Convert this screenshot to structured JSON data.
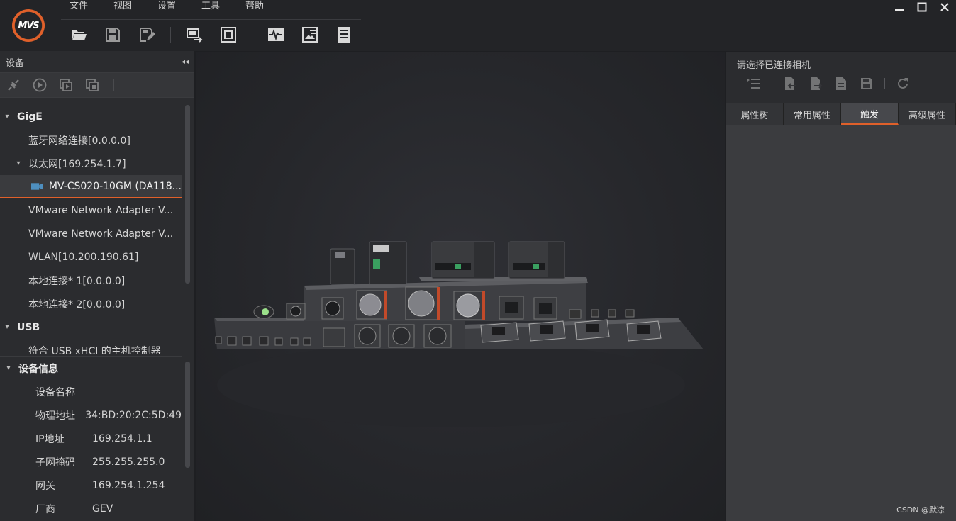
{
  "app": {
    "logo_text": "MVS",
    "menu": [
      "文件",
      "视图",
      "设置",
      "工具",
      "帮助"
    ],
    "toolbar_icons": [
      "open-folder-icon",
      "save-icon",
      "save-as-icon",
      "display-switch-icon",
      "fullscreen-icon",
      "waveform-icon",
      "image-info-icon",
      "list-icon"
    ],
    "accent": "#e0602a"
  },
  "left_panel": {
    "title": "设备",
    "collapse_glyph": "◂◂",
    "tools": [
      "connect-icon",
      "play-icon",
      "record-icon",
      "snapshot-icon"
    ],
    "tree": [
      {
        "type": "group",
        "caret": "▾",
        "label": "GigE"
      },
      {
        "type": "item",
        "label": "蓝牙网络连接[0.0.0.0]"
      },
      {
        "type": "sub",
        "caret": "▾",
        "label": "以太网[169.254.1.7]"
      },
      {
        "type": "camera",
        "label": "MV-CS020-10GM (DA118...",
        "selected": true
      },
      {
        "type": "item",
        "label": "VMware Network Adapter V..."
      },
      {
        "type": "item",
        "label": "VMware Network Adapter V..."
      },
      {
        "type": "item",
        "label": "WLAN[10.200.190.61]"
      },
      {
        "type": "item",
        "label": "本地连接* 1[0.0.0.0]"
      },
      {
        "type": "item",
        "label": "本地连接* 2[0.0.0.0]"
      },
      {
        "type": "group",
        "caret": "▾",
        "label": "USB"
      },
      {
        "type": "item",
        "label": "符合 USB xHCI 的主机控制器"
      }
    ],
    "device_info": {
      "title": "设备信息",
      "caret": "▾",
      "rows": [
        {
          "key": "设备名称",
          "value": ""
        },
        {
          "key": "物理地址",
          "value": "34:BD:20:2C:5D:49"
        },
        {
          "key": "IP地址",
          "value": "169.254.1.1"
        },
        {
          "key": "子网掩码",
          "value": "255.255.255.0"
        },
        {
          "key": "网关",
          "value": "169.254.1.254"
        },
        {
          "key": "厂商",
          "value": "GEV"
        }
      ]
    }
  },
  "right_panel": {
    "title": "请选择已连接相机",
    "tools": [
      "tree-list-icon",
      "import-icon",
      "export-icon",
      "file-icon",
      "save-icon",
      "refresh-icon"
    ],
    "tabs": [
      {
        "label": "属性树",
        "active": false
      },
      {
        "label": "常用属性",
        "active": false
      },
      {
        "label": "触发",
        "active": true
      },
      {
        "label": "高级属性",
        "active": false
      }
    ]
  },
  "watermark": "CSDN @默凉"
}
